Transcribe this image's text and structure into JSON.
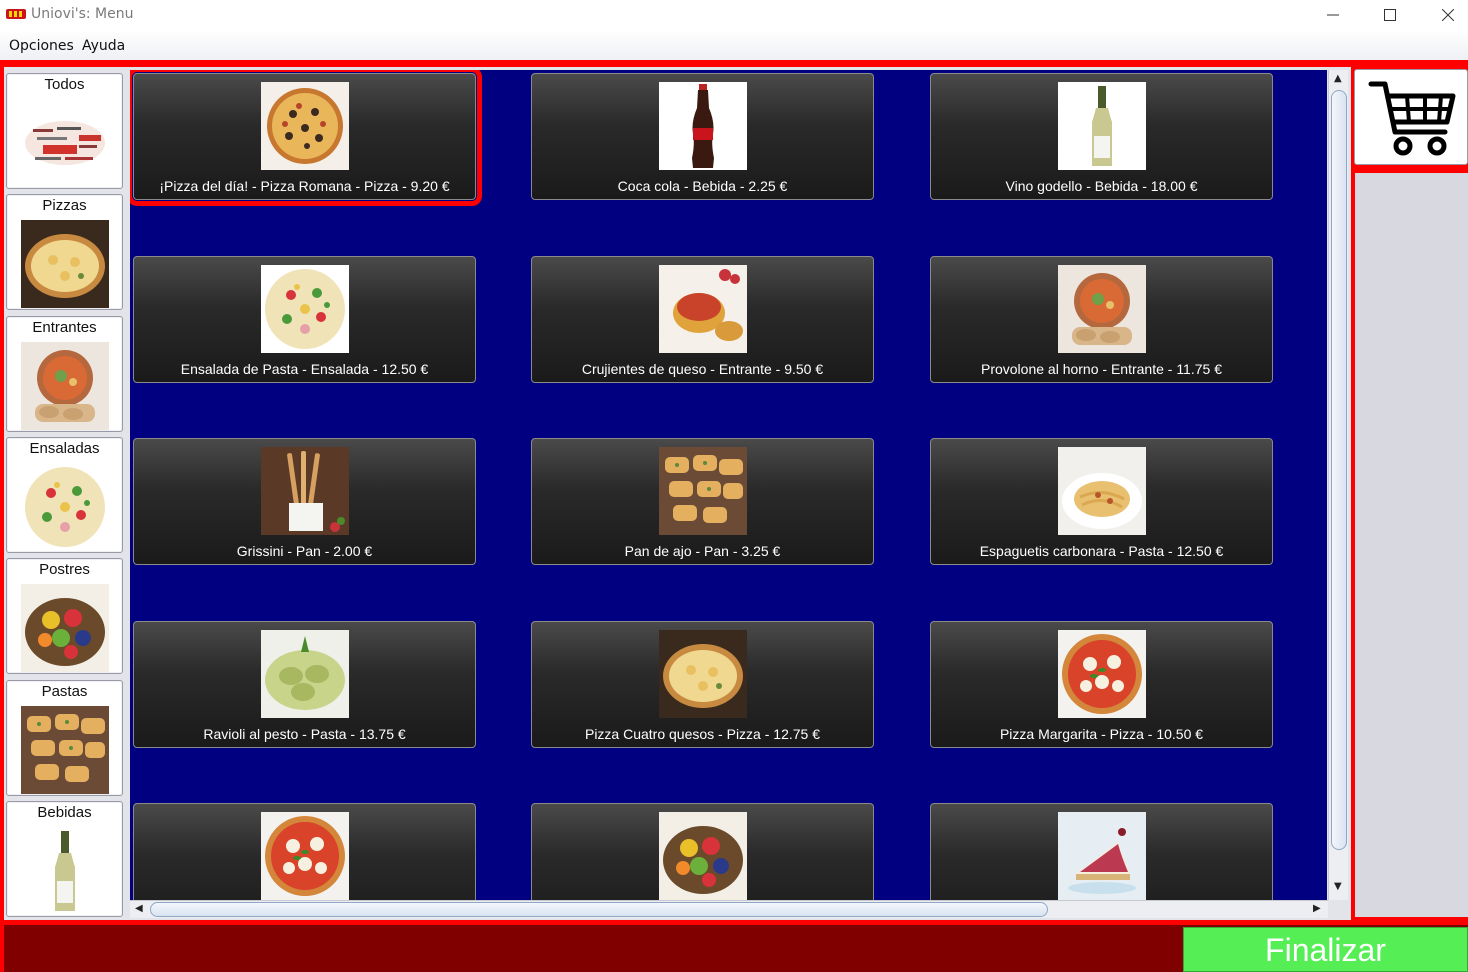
{
  "window": {
    "title": "Uniovi's: Menu"
  },
  "menubar": {
    "items": [
      {
        "label": "Opciones",
        "mnemonic": "O"
      },
      {
        "label": "Ayuda",
        "mnemonic": "A"
      }
    ]
  },
  "categories": [
    {
      "label": "Todos",
      "icon": "word-cloud-pizza-image"
    },
    {
      "label": "Pizzas",
      "icon": "pizza-image"
    },
    {
      "label": "Entrantes",
      "icon": "provolone-image"
    },
    {
      "label": "Ensaladas",
      "icon": "pasta-salad-image"
    },
    {
      "label": "Postres",
      "icon": "fruit-bowl-image"
    },
    {
      "label": "Pastas",
      "icon": "garlic-bread-image"
    },
    {
      "label": "Bebidas",
      "icon": "wine-bottle-image"
    }
  ],
  "products": [
    {
      "label": "¡Pizza del día! - Pizza Romana - Pizza - 9.20 €",
      "icon": "pizza-image",
      "selected": true
    },
    {
      "label": "Coca cola - Bebida - 2.25 €",
      "icon": "coca-cola-bottle-image"
    },
    {
      "label": "Vino godello - Bebida - 18.00 €",
      "icon": "wine-bottle-image"
    },
    {
      "label": "Ensalada de Pasta - Ensalada - 12.50 €",
      "icon": "pasta-salad-image"
    },
    {
      "label": "Crujientes de queso - Entrante - 9.50 €",
      "icon": "cheese-crisps-image"
    },
    {
      "label": "Provolone al horno - Entrante - 11.75 €",
      "icon": "provolone-image"
    },
    {
      "label": "Grissini - Pan - 2.00 €",
      "icon": "grissini-image"
    },
    {
      "label": "Pan de ajo - Pan - 3.25 €",
      "icon": "garlic-bread-image"
    },
    {
      "label": "Espaguetis carbonara - Pasta - 12.50 €",
      "icon": "spaghetti-image"
    },
    {
      "label": "Ravioli al pesto - Pasta - 13.75 €",
      "icon": "pesto-ravioli-image"
    },
    {
      "label": "Pizza Cuatro quesos - Pizza - 12.75 €",
      "icon": "four-cheese-pizza-image"
    },
    {
      "label": "Pizza Margarita - Pizza - 10.50 €",
      "icon": "margherita-pizza-image"
    },
    {
      "label": "",
      "icon": "pizza-image"
    },
    {
      "label": "",
      "icon": "fruit-bowl-image"
    },
    {
      "label": "",
      "icon": "cheesecake-image"
    }
  ],
  "cart": {
    "icon": "shopping-cart-icon"
  },
  "footer": {
    "finish_label": "Finalizar"
  },
  "colors": {
    "frame": "#ff0000",
    "grid_background": "#000080",
    "footer": "#800000",
    "finish_button": "#55ee55",
    "selected_outline": "#ff0000"
  }
}
